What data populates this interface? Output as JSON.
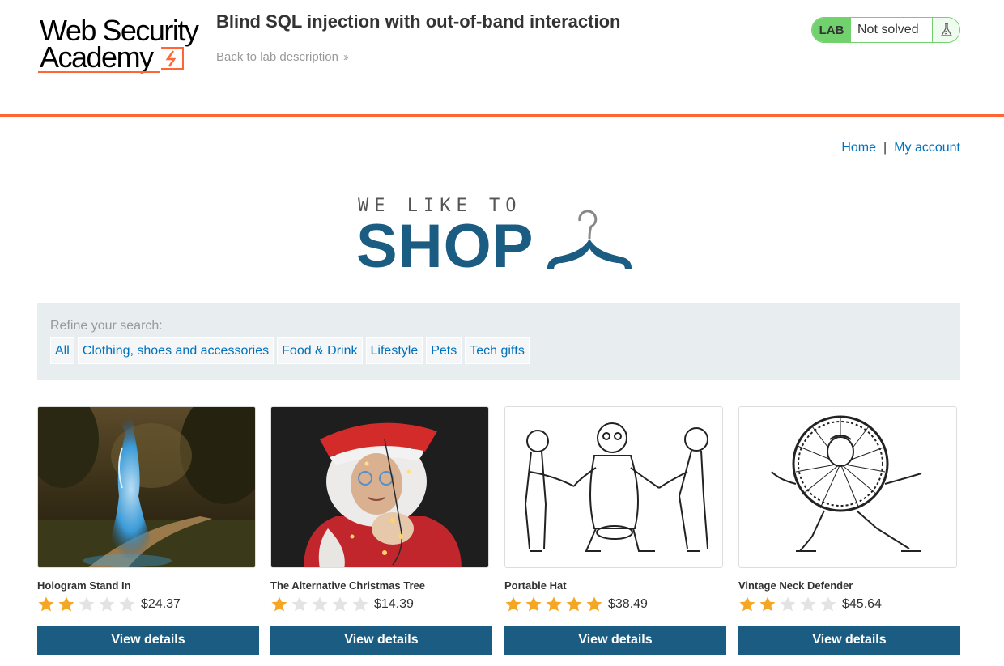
{
  "header": {
    "logo_line1": "Web Security",
    "logo_line2": "Academy",
    "lab_title": "Blind SQL injection with out-of-band interaction",
    "back_link": "Back to lab description",
    "lab_badge": "LAB",
    "lab_status": "Not solved",
    "colors": {
      "accent": "#ff6633",
      "solved_green": "#70d16d"
    }
  },
  "nav": {
    "home": "Home",
    "separator": "|",
    "my_account": "My account"
  },
  "banner": {
    "top_text": "WE LIKE TO",
    "big_text": "SHOP",
    "icon": "hanger-icon",
    "color": "#1a5c82"
  },
  "filter": {
    "label": "Refine your search:",
    "categories": [
      "All",
      "Clothing, shoes and accessories",
      "Food & Drink",
      "Lifestyle",
      "Pets",
      "Tech gifts"
    ]
  },
  "products": [
    {
      "name": "Hologram Stand In",
      "rating": 2,
      "max_rating": 5,
      "price": "$24.37",
      "button": "View details"
    },
    {
      "name": "The Alternative Christmas Tree",
      "rating": 1,
      "max_rating": 5,
      "price": "$14.39",
      "button": "View details"
    },
    {
      "name": "Portable Hat",
      "rating": 5,
      "max_rating": 5,
      "price": "$38.49",
      "button": "View details"
    },
    {
      "name": "Vintage Neck Defender",
      "rating": 2,
      "max_rating": 5,
      "price": "$45.64",
      "button": "View details"
    }
  ]
}
